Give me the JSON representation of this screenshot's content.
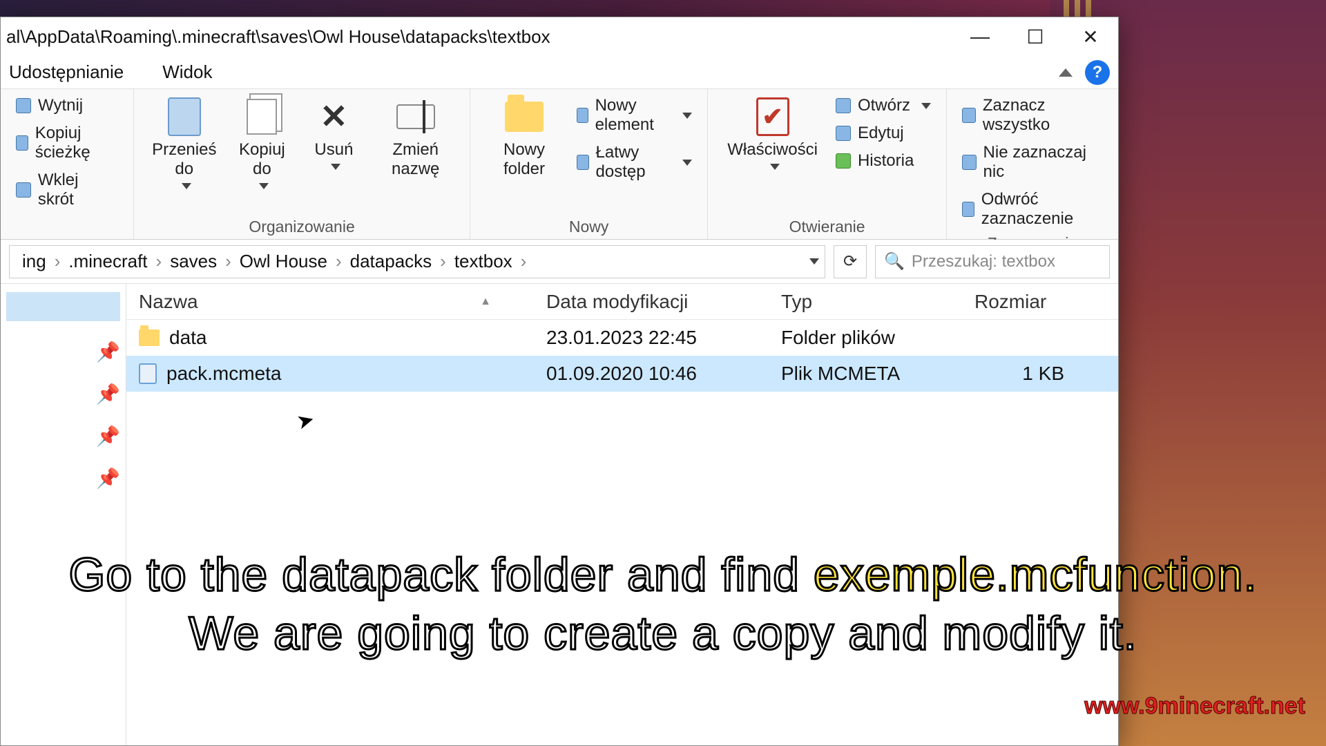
{
  "window": {
    "title_path": "al\\AppData\\Roaming\\.minecraft\\saves\\Owl House\\datapacks\\textbox"
  },
  "menubar": {
    "items": [
      "Udostępnianie",
      "Widok"
    ]
  },
  "ribbon": {
    "clipboard": {
      "cut": "Wytnij",
      "copy_path": "Kopiuj ścieżkę",
      "paste_shortcut": "Wklej skrót"
    },
    "organize": {
      "move_to": "Przenieś do",
      "copy_to": "Kopiuj do",
      "delete": "Usuń",
      "rename": "Zmień nazwę",
      "group_label": "Organizowanie"
    },
    "new": {
      "new_folder": "Nowy folder",
      "new_item": "Nowy element",
      "easy_access": "Łatwy dostęp",
      "group_label": "Nowy"
    },
    "open": {
      "properties": "Właściwości",
      "open": "Otwórz",
      "edit": "Edytuj",
      "history": "Historia",
      "group_label": "Otwieranie"
    },
    "select": {
      "select_all": "Zaznacz wszystko",
      "select_none": "Nie zaznaczaj nic",
      "invert": "Odwróć zaznaczenie",
      "group_label": "Zaznaczanie"
    }
  },
  "breadcrumb": {
    "items": [
      "ing",
      ".minecraft",
      "saves",
      "Owl House",
      "datapacks",
      "textbox"
    ]
  },
  "search": {
    "placeholder": "Przeszukaj: textbox"
  },
  "columns": {
    "name": "Nazwa",
    "modified": "Data modyfikacji",
    "type": "Typ",
    "size": "Rozmiar"
  },
  "files": [
    {
      "name": "data",
      "modified": "23.01.2023 22:45",
      "type": "Folder plików",
      "size": "",
      "is_folder": true
    },
    {
      "name": "pack.mcmeta",
      "modified": "01.09.2020 10:46",
      "type": "Plik MCMETA",
      "size": "1 KB",
      "is_folder": false
    }
  ],
  "caption": {
    "line1_a": "Go to the datapack folder and find ",
    "line1_hl": "exemple.mcfunction.",
    "line2": "We are going to create a copy and modify it."
  },
  "watermark": "www.9minecraft.net"
}
